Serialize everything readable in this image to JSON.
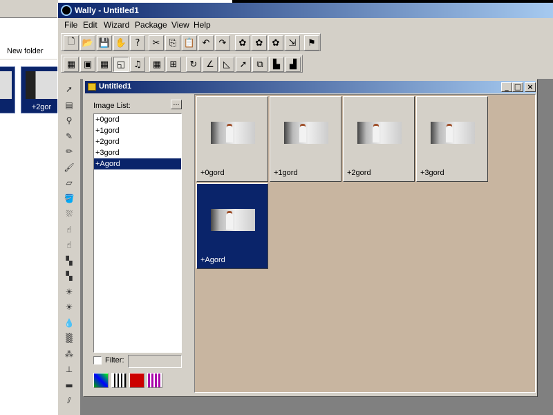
{
  "background_window": {
    "new_folder_label": "New folder",
    "thumbnail_label": "+2gor"
  },
  "app": {
    "title": "Wally - Untitled1"
  },
  "menu": [
    "File",
    "Edit",
    "Wizard",
    "Package",
    "View",
    "Help"
  ],
  "toolbar1": [
    {
      "name": "new-icon",
      "glyph": "🗋"
    },
    {
      "name": "open-icon",
      "glyph": "📂"
    },
    {
      "name": "save-icon",
      "glyph": "💾"
    },
    {
      "name": "whats-this-icon",
      "glyph": "✋"
    },
    {
      "name": "help-icon",
      "glyph": "?"
    },
    {
      "name": "cut-icon",
      "glyph": "✂"
    },
    {
      "name": "copy-icon",
      "glyph": "⎘"
    },
    {
      "name": "paste-icon",
      "glyph": "📋"
    },
    {
      "name": "undo-icon",
      "glyph": "↶"
    },
    {
      "name": "redo-icon",
      "glyph": "↷"
    },
    {
      "name": "package-new-icon",
      "glyph": "✿"
    },
    {
      "name": "package-add-icon",
      "glyph": "✿"
    },
    {
      "name": "package-open-icon",
      "glyph": "✿"
    },
    {
      "name": "package-remove-icon",
      "glyph": "⇲"
    },
    {
      "name": "package-export-icon",
      "glyph": "⚑"
    }
  ],
  "toolbar2": [
    {
      "name": "palette-view-icon",
      "glyph": "▦"
    },
    {
      "name": "image-view-icon",
      "glyph": "▣"
    },
    {
      "name": "grid-view-icon",
      "glyph": "▦"
    },
    {
      "name": "browser-view-icon",
      "glyph": "◱"
    },
    {
      "name": "sound-icon",
      "glyph": "♫"
    },
    {
      "name": "tile-grid-icon",
      "glyph": "▦"
    },
    {
      "name": "tile-quad-icon",
      "glyph": "⊞"
    },
    {
      "name": "rotate-icon",
      "glyph": "↻"
    },
    {
      "name": "flip-icon",
      "glyph": "∠"
    },
    {
      "name": "mirror-icon",
      "glyph": "◺"
    },
    {
      "name": "pointer-icon",
      "glyph": "➚"
    },
    {
      "name": "offset-icon",
      "glyph": "⧉"
    },
    {
      "name": "tile-left-icon",
      "glyph": "▙"
    },
    {
      "name": "tile-right-icon",
      "glyph": "▟"
    }
  ],
  "palette_tools": [
    "pointer-icon",
    "ruler-icon",
    "zoom-icon",
    "eyedropper-icon",
    "pencil-icon",
    "brush-icon",
    "eraser-icon",
    "fill-icon",
    "spray-icon",
    "smudge-icon",
    "dodge-icon",
    "burn-icon",
    "sharpen-icon",
    "brighten-icon",
    "darken-icon",
    "drop-icon",
    "blur-icon",
    "scatter-icon",
    "stamp-icon",
    "line-icon",
    "pattern-icon"
  ],
  "child": {
    "title": "Untitled1",
    "image_list_label": "Image List:",
    "browse_label": "...",
    "filter_label": "Filter:",
    "images": [
      "+0gord",
      "+1gord",
      "+2gord",
      "+3gord",
      "+Agord"
    ],
    "selected_index": 4
  },
  "view_buttons": [
    "color-view-icon",
    "frame-view-icon",
    "red-grid-icon",
    "purple-grid-icon"
  ]
}
